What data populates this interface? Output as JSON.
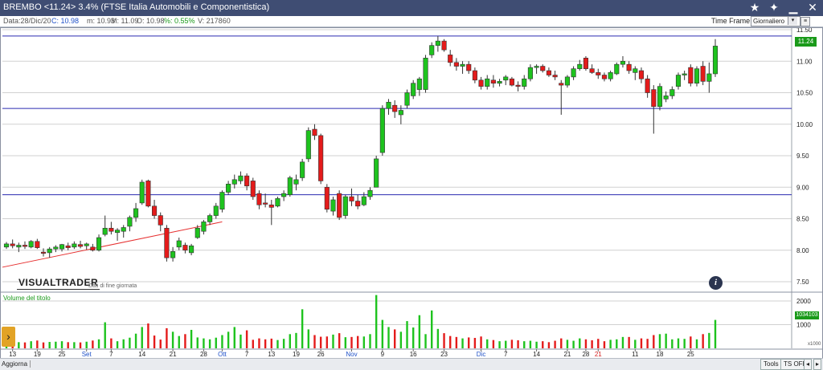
{
  "window": {
    "title": "BREMBO <11.24> 3.4%  (FTSE Italia Automobili e Componentistica)"
  },
  "infobar": {
    "date": "Data:28/Dic/20",
    "close": "C: 10.98",
    "min": "m: 10.93",
    "max": "M: 11.09",
    "open": "O: 10.98",
    "pct": "%: 0.55%",
    "volume": "V: 217860"
  },
  "toolbar": {
    "timeframe_label": "Time Frame",
    "timeframe_value": "Giornaliero"
  },
  "branding": {
    "logo": "VISUALTRADER",
    "note": "Dati di fine giornata"
  },
  "price_tag": "11.24",
  "volume_tag": "1034103",
  "volume_label": "Volume del titolo",
  "volume_unit": "x1000",
  "bottom": {
    "refresh": "Aggiorna",
    "tools": "Tools",
    "tsoff": "TS OFF"
  },
  "colors": {
    "up": "#1ec31e",
    "down": "#e41b1b",
    "grid": "#d0d0d0",
    "hline": "#2a2ab0",
    "trend": "#e63030",
    "titlebar": "#3f4d73"
  },
  "chart_data": {
    "type": "candlestick",
    "yaxis_ticks": [
      "11.50",
      "11.00",
      "10.50",
      "10.00",
      "9.50",
      "9.00",
      "8.50",
      "8.00",
      "7.50"
    ],
    "ylim": [
      7.5,
      11.5
    ],
    "volume_ticks": [
      "2000",
      "1000"
    ],
    "volume_ylim": [
      0,
      2000
    ],
    "horizontal_lines": [
      11.4,
      10.25,
      8.88
    ],
    "trendline": [
      {
        "i": 0,
        "y": 7.73
      },
      {
        "i": 35,
        "y": 8.45
      }
    ],
    "xtick_labels": [
      {
        "i": 1,
        "label": "13"
      },
      {
        "i": 5,
        "label": "19"
      },
      {
        "i": 9,
        "label": "25"
      },
      {
        "i": 13,
        "label": "Set",
        "month": true
      },
      {
        "i": 17,
        "label": "7"
      },
      {
        "i": 22,
        "label": "14"
      },
      {
        "i": 27,
        "label": "21"
      },
      {
        "i": 32,
        "label": "28"
      },
      {
        "i": 35,
        "label": "Ott",
        "month": true
      },
      {
        "i": 39,
        "label": "7"
      },
      {
        "i": 43,
        "label": "13"
      },
      {
        "i": 47,
        "label": "19"
      },
      {
        "i": 51,
        "label": "26"
      },
      {
        "i": 56,
        "label": "Nov",
        "month": true
      },
      {
        "i": 61,
        "label": "9"
      },
      {
        "i": 66,
        "label": "16"
      },
      {
        "i": 71,
        "label": "23"
      },
      {
        "i": 77,
        "label": "Dic",
        "month": true
      },
      {
        "i": 81,
        "label": "7"
      },
      {
        "i": 86,
        "label": "14"
      },
      {
        "i": 91,
        "label": "21"
      },
      {
        "i": 94,
        "label": "28"
      },
      {
        "i": 96,
        "label": "21",
        "red": true
      },
      {
        "i": 102,
        "label": "11"
      },
      {
        "i": 106,
        "label": "18"
      },
      {
        "i": 111,
        "label": "25"
      }
    ],
    "candles": [
      {
        "o": 8.05,
        "h": 8.13,
        "l": 8.02,
        "c": 8.1
      },
      {
        "o": 8.1,
        "h": 8.17,
        "l": 8.03,
        "c": 8.07
      },
      {
        "o": 8.05,
        "h": 8.12,
        "l": 7.97,
        "c": 8.08
      },
      {
        "o": 8.08,
        "h": 8.14,
        "l": 8.02,
        "c": 8.06
      },
      {
        "o": 8.05,
        "h": 8.16,
        "l": 8.03,
        "c": 8.14
      },
      {
        "o": 8.14,
        "h": 8.18,
        "l": 8.02,
        "c": 8.04
      },
      {
        "o": 7.97,
        "h": 8.03,
        "l": 7.9,
        "c": 7.95
      },
      {
        "o": 7.96,
        "h": 8.05,
        "l": 7.88,
        "c": 8.02
      },
      {
        "o": 8.02,
        "h": 8.08,
        "l": 7.97,
        "c": 8.05
      },
      {
        "o": 8.02,
        "h": 8.1,
        "l": 7.98,
        "c": 8.09
      },
      {
        "o": 8.07,
        "h": 8.12,
        "l": 8.0,
        "c": 8.04
      },
      {
        "o": 8.05,
        "h": 8.14,
        "l": 8.02,
        "c": 8.1
      },
      {
        "o": 8.09,
        "h": 8.15,
        "l": 8.03,
        "c": 8.06
      },
      {
        "o": 8.07,
        "h": 8.12,
        "l": 8.01,
        "c": 8.1
      },
      {
        "o": 8.05,
        "h": 8.1,
        "l": 7.98,
        "c": 8.0
      },
      {
        "o": 8.0,
        "h": 8.25,
        "l": 7.98,
        "c": 8.2
      },
      {
        "o": 8.25,
        "h": 8.55,
        "l": 8.22,
        "c": 8.35
      },
      {
        "o": 8.35,
        "h": 8.45,
        "l": 8.25,
        "c": 8.3
      },
      {
        "o": 8.28,
        "h": 8.35,
        "l": 8.15,
        "c": 8.32
      },
      {
        "o": 8.3,
        "h": 8.4,
        "l": 8.2,
        "c": 8.36
      },
      {
        "o": 8.38,
        "h": 8.55,
        "l": 8.3,
        "c": 8.52
      },
      {
        "o": 8.52,
        "h": 8.75,
        "l": 8.45,
        "c": 8.66
      },
      {
        "o": 8.75,
        "h": 9.12,
        "l": 8.72,
        "c": 9.08
      },
      {
        "o": 9.1,
        "h": 9.12,
        "l": 8.68,
        "c": 8.7
      },
      {
        "o": 8.7,
        "h": 8.8,
        "l": 8.5,
        "c": 8.55
      },
      {
        "o": 8.55,
        "h": 8.6,
        "l": 8.3,
        "c": 8.4
      },
      {
        "o": 8.35,
        "h": 8.4,
        "l": 7.82,
        "c": 7.88
      },
      {
        "o": 7.88,
        "h": 8.05,
        "l": 7.82,
        "c": 7.98
      },
      {
        "o": 8.05,
        "h": 8.2,
        "l": 8.0,
        "c": 8.15
      },
      {
        "o": 8.08,
        "h": 8.12,
        "l": 7.95,
        "c": 8.0
      },
      {
        "o": 7.96,
        "h": 8.1,
        "l": 7.92,
        "c": 8.07
      },
      {
        "o": 8.2,
        "h": 8.4,
        "l": 8.18,
        "c": 8.35
      },
      {
        "o": 8.3,
        "h": 8.48,
        "l": 8.25,
        "c": 8.45
      },
      {
        "o": 8.45,
        "h": 8.58,
        "l": 8.4,
        "c": 8.55
      },
      {
        "o": 8.55,
        "h": 8.75,
        "l": 8.5,
        "c": 8.7
      },
      {
        "o": 8.65,
        "h": 8.95,
        "l": 8.6,
        "c": 8.92
      },
      {
        "o": 8.92,
        "h": 9.1,
        "l": 8.88,
        "c": 9.05
      },
      {
        "o": 9.05,
        "h": 9.2,
        "l": 8.98,
        "c": 9.12
      },
      {
        "o": 9.1,
        "h": 9.25,
        "l": 9.05,
        "c": 9.18
      },
      {
        "o": 9.18,
        "h": 9.22,
        "l": 8.95,
        "c": 9.02
      },
      {
        "o": 9.1,
        "h": 9.15,
        "l": 8.8,
        "c": 8.85
      },
      {
        "o": 8.9,
        "h": 8.95,
        "l": 8.65,
        "c": 8.72
      },
      {
        "o": 8.75,
        "h": 8.9,
        "l": 8.68,
        "c": 8.73
      },
      {
        "o": 8.72,
        "h": 8.8,
        "l": 8.4,
        "c": 8.68
      },
      {
        "o": 8.7,
        "h": 8.85,
        "l": 8.68,
        "c": 8.82
      },
      {
        "o": 8.85,
        "h": 8.95,
        "l": 8.78,
        "c": 8.9
      },
      {
        "o": 8.88,
        "h": 9.18,
        "l": 8.85,
        "c": 9.15
      },
      {
        "o": 9.05,
        "h": 9.2,
        "l": 8.95,
        "c": 9.12
      },
      {
        "o": 9.15,
        "h": 9.45,
        "l": 9.1,
        "c": 9.4
      },
      {
        "o": 9.45,
        "h": 9.95,
        "l": 9.4,
        "c": 9.9
      },
      {
        "o": 9.92,
        "h": 10.0,
        "l": 9.75,
        "c": 9.82
      },
      {
        "o": 9.82,
        "h": 9.85,
        "l": 9.05,
        "c": 9.1
      },
      {
        "o": 9.0,
        "h": 9.05,
        "l": 8.6,
        "c": 8.65
      },
      {
        "o": 8.62,
        "h": 8.85,
        "l": 8.55,
        "c": 8.8
      },
      {
        "o": 8.9,
        "h": 8.95,
        "l": 8.48,
        "c": 8.52
      },
      {
        "o": 8.55,
        "h": 8.88,
        "l": 8.5,
        "c": 8.85
      },
      {
        "o": 8.85,
        "h": 8.98,
        "l": 8.7,
        "c": 8.78
      },
      {
        "o": 8.78,
        "h": 8.88,
        "l": 8.65,
        "c": 8.7
      },
      {
        "o": 8.72,
        "h": 8.92,
        "l": 8.7,
        "c": 8.85
      },
      {
        "o": 8.85,
        "h": 9.0,
        "l": 8.8,
        "c": 8.95
      },
      {
        "o": 9.0,
        "h": 9.5,
        "l": 9.05,
        "c": 9.45
      },
      {
        "o": 9.55,
        "h": 10.3,
        "l": 9.5,
        "c": 10.25
      },
      {
        "o": 10.25,
        "h": 10.4,
        "l": 10.15,
        "c": 10.35
      },
      {
        "o": 10.3,
        "h": 10.38,
        "l": 10.1,
        "c": 10.2
      },
      {
        "o": 10.15,
        "h": 10.3,
        "l": 10.0,
        "c": 10.22
      },
      {
        "o": 10.3,
        "h": 10.55,
        "l": 10.25,
        "c": 10.5
      },
      {
        "o": 10.45,
        "h": 10.7,
        "l": 10.4,
        "c": 10.65
      },
      {
        "o": 10.55,
        "h": 10.75,
        "l": 10.45,
        "c": 10.72
      },
      {
        "o": 10.55,
        "h": 11.1,
        "l": 10.5,
        "c": 11.05
      },
      {
        "o": 11.1,
        "h": 11.3,
        "l": 11.05,
        "c": 11.25
      },
      {
        "o": 11.25,
        "h": 11.4,
        "l": 11.15,
        "c": 11.32
      },
      {
        "o": 11.32,
        "h": 11.35,
        "l": 11.15,
        "c": 11.18
      },
      {
        "o": 11.1,
        "h": 11.18,
        "l": 10.92,
        "c": 10.98
      },
      {
        "o": 10.98,
        "h": 11.05,
        "l": 10.85,
        "c": 10.92
      },
      {
        "o": 10.92,
        "h": 11.0,
        "l": 10.8,
        "c": 10.95
      },
      {
        "o": 10.95,
        "h": 11.0,
        "l": 10.8,
        "c": 10.85
      },
      {
        "o": 10.85,
        "h": 10.9,
        "l": 10.65,
        "c": 10.7
      },
      {
        "o": 10.7,
        "h": 10.75,
        "l": 10.55,
        "c": 10.6
      },
      {
        "o": 10.6,
        "h": 10.78,
        "l": 10.55,
        "c": 10.72
      },
      {
        "o": 10.7,
        "h": 10.78,
        "l": 10.58,
        "c": 10.65
      },
      {
        "o": 10.65,
        "h": 10.72,
        "l": 10.6,
        "c": 10.68
      },
      {
        "o": 10.7,
        "h": 10.78,
        "l": 10.62,
        "c": 10.75
      },
      {
        "o": 10.72,
        "h": 10.75,
        "l": 10.6,
        "c": 10.62
      },
      {
        "o": 10.62,
        "h": 10.68,
        "l": 10.52,
        "c": 10.6
      },
      {
        "o": 10.6,
        "h": 10.78,
        "l": 10.55,
        "c": 10.72
      },
      {
        "o": 10.72,
        "h": 10.95,
        "l": 10.68,
        "c": 10.9
      },
      {
        "o": 10.9,
        "h": 10.95,
        "l": 10.8,
        "c": 10.92
      },
      {
        "o": 10.92,
        "h": 10.95,
        "l": 10.82,
        "c": 10.85
      },
      {
        "o": 10.85,
        "h": 10.9,
        "l": 10.75,
        "c": 10.78
      },
      {
        "o": 10.78,
        "h": 10.85,
        "l": 10.7,
        "c": 10.75
      },
      {
        "o": 10.65,
        "h": 10.7,
        "l": 10.15,
        "c": 10.62
      },
      {
        "o": 10.62,
        "h": 10.78,
        "l": 10.58,
        "c": 10.75
      },
      {
        "o": 10.75,
        "h": 10.92,
        "l": 10.7,
        "c": 10.88
      },
      {
        "o": 10.88,
        "h": 11.02,
        "l": 10.85,
        "c": 10.95
      },
      {
        "o": 11.05,
        "h": 11.08,
        "l": 10.85,
        "c": 10.88
      },
      {
        "o": 10.88,
        "h": 10.95,
        "l": 10.8,
        "c": 10.82
      },
      {
        "o": 10.82,
        "h": 10.88,
        "l": 10.72,
        "c": 10.78
      },
      {
        "o": 10.78,
        "h": 10.82,
        "l": 10.68,
        "c": 10.72
      },
      {
        "o": 10.72,
        "h": 10.85,
        "l": 10.68,
        "c": 10.82
      },
      {
        "o": 10.8,
        "h": 10.98,
        "l": 10.78,
        "c": 10.95
      },
      {
        "o": 10.95,
        "h": 11.08,
        "l": 10.9,
        "c": 11.0
      },
      {
        "o": 10.95,
        "h": 11.0,
        "l": 10.8,
        "c": 10.85
      },
      {
        "o": 10.82,
        "h": 10.92,
        "l": 10.7,
        "c": 10.88
      },
      {
        "o": 10.85,
        "h": 10.9,
        "l": 10.65,
        "c": 10.72
      },
      {
        "o": 10.72,
        "h": 10.78,
        "l": 10.42,
        "c": 10.5
      },
      {
        "o": 10.55,
        "h": 10.62,
        "l": 9.85,
        "c": 10.28
      },
      {
        "o": 10.28,
        "h": 10.65,
        "l": 10.22,
        "c": 10.6
      },
      {
        "o": 10.4,
        "h": 10.52,
        "l": 10.35,
        "c": 10.45
      },
      {
        "o": 10.45,
        "h": 10.6,
        "l": 10.4,
        "c": 10.55
      },
      {
        "o": 10.6,
        "h": 10.82,
        "l": 10.55,
        "c": 10.78
      },
      {
        "o": 10.78,
        "h": 10.85,
        "l": 10.7,
        "c": 10.8
      },
      {
        "o": 10.9,
        "h": 10.95,
        "l": 10.6,
        "c": 10.65
      },
      {
        "o": 10.65,
        "h": 10.92,
        "l": 10.6,
        "c": 10.88
      },
      {
        "o": 10.92,
        "h": 11.0,
        "l": 10.62,
        "c": 10.68
      },
      {
        "o": 10.68,
        "h": 10.98,
        "l": 10.5,
        "c": 10.8
      },
      {
        "o": 10.8,
        "h": 11.35,
        "l": 10.75,
        "c": 11.24
      }
    ],
    "volume": [
      300,
      280,
      260,
      250,
      300,
      330,
      250,
      270,
      280,
      300,
      260,
      260,
      250,
      280,
      330,
      380,
      1100,
      420,
      300,
      380,
      450,
      620,
      900,
      1050,
      540,
      370,
      850,
      700,
      520,
      600,
      780,
      460,
      420,
      380,
      450,
      560,
      700,
      900,
      580,
      760,
      360,
      420,
      380,
      410,
      350,
      400,
      600,
      650,
      1650,
      800,
      560,
      490,
      500,
      580,
      640,
      470,
      480,
      520,
      500,
      600,
      2250,
      1200,
      900,
      800,
      700,
      1150,
      880,
      1400,
      600,
      1600,
      820,
      640,
      520,
      480,
      420,
      460,
      440,
      500,
      380,
      350,
      300,
      320,
      360,
      340,
      300,
      320,
      280,
      300,
      260,
      320,
      420,
      360,
      320,
      420,
      380,
      340,
      400,
      300,
      360,
      380,
      480,
      480,
      360,
      420,
      400,
      560,
      600,
      620,
      380,
      420,
      400,
      500,
      380,
      600,
      650,
      1200
    ]
  }
}
